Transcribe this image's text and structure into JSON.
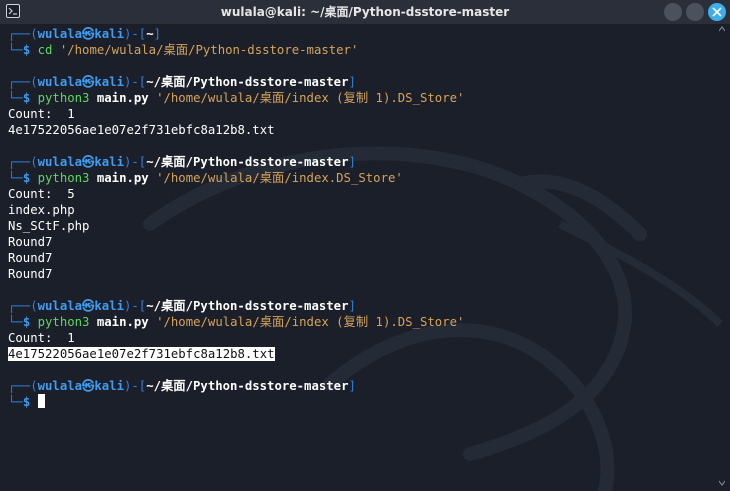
{
  "window": {
    "title": "wulala@kali: ~/桌面/Python-dsstore-master"
  },
  "prompt": {
    "user": "wulala",
    "at": "㉿",
    "host": "kali",
    "symbol": "$"
  },
  "blocks": [
    {
      "path": "~",
      "cmd": "cd",
      "args": "'/home/wulala/桌面/Python-dsstore-master'"
    },
    {
      "path": "~/桌面/Python-dsstore-master",
      "cmd": "python3",
      "script": "main.py",
      "args": "'/home/wulala/桌面/index (复制 1).DS_Store'",
      "output": [
        "Count:  1",
        "4e17522056ae1e07e2f731ebfc8a12b8.txt"
      ]
    },
    {
      "path": "~/桌面/Python-dsstore-master",
      "cmd": "python3",
      "script": "main.py",
      "args": "'/home/wulala/桌面/index.DS_Store'",
      "output": [
        "Count:  5",
        "index.php",
        "Ns_SCtF.php",
        "Round7",
        "Round7",
        "Round7"
      ]
    },
    {
      "path": "~/桌面/Python-dsstore-master",
      "cmd": "python3",
      "script": "main.py",
      "args": "'/home/wulala/桌面/index (复制 1).DS_Store'",
      "output": [
        "Count:  1",
        "4e17522056ae1e07e2f731ebfc8a12b8.txt"
      ]
    },
    {
      "path": "~/桌面/Python-dsstore-master"
    }
  ],
  "colors": {
    "prompt_frame": "#2f7ed8",
    "user_host": "#3f9cf0",
    "command": "#5fd75f",
    "argument": "#d7a35a",
    "close_button": "#3daee9"
  },
  "icons": [
    "terminal-icon",
    "minimize-icon",
    "maximize-icon",
    "close-icon",
    "kali-dragon-watermark"
  ]
}
